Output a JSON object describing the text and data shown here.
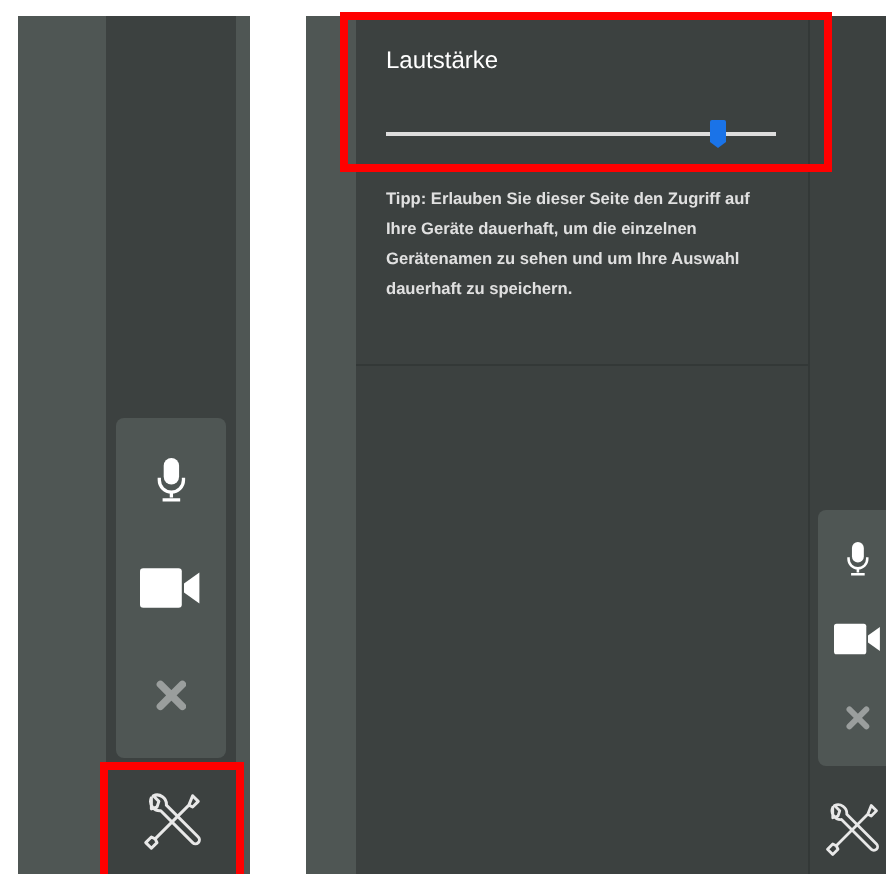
{
  "left_view": {
    "toolbar": [
      {
        "kind": "mic",
        "disabled": false
      },
      {
        "kind": "video",
        "disabled": false
      },
      {
        "kind": "close",
        "disabled": true
      }
    ],
    "tools_button": {
      "highlighted": true
    }
  },
  "right_view": {
    "volume": {
      "label": "Lautstärke",
      "level": 0.85,
      "highlighted": true
    },
    "tip": "Tipp: Erlauben Sie dieser Seite den Zugriff auf Ihre Geräte dauerhaft, um die einzelnen Gerätenamen zu sehen und um Ihre Auswahl dauerhaft zu speichern.",
    "toolbar": [
      {
        "kind": "mic",
        "disabled": false
      },
      {
        "kind": "video",
        "disabled": false
      },
      {
        "kind": "close",
        "disabled": true
      }
    ],
    "tools_button": {
      "highlighted": false
    }
  }
}
